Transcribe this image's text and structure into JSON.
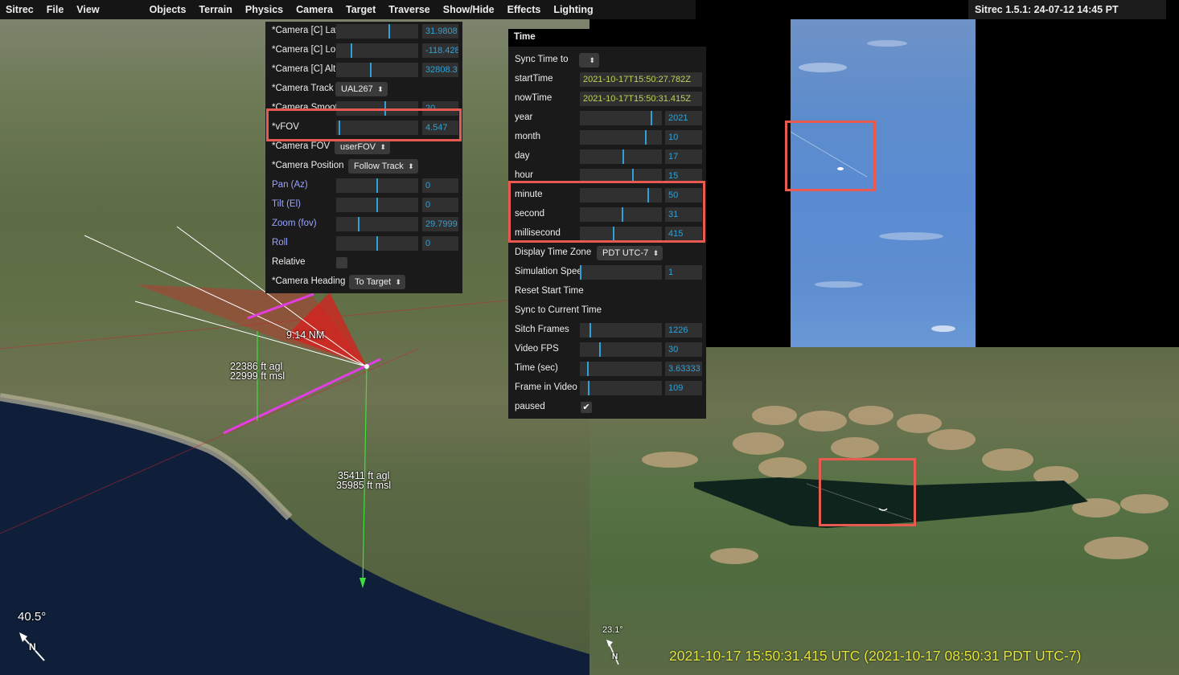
{
  "menu": {
    "app": "Sitrec",
    "items": [
      "File",
      "View",
      "Objects",
      "Terrain",
      "Physics",
      "Camera",
      "Target",
      "Traverse",
      "Show/Hide",
      "Effects",
      "Lighting"
    ],
    "version": "Sitrec 1.5.1: 24-07-12 14:45 PT"
  },
  "camera_panel": {
    "rows": [
      {
        "label": "*Camera [C] Lat",
        "type": "slider",
        "value": "31.9808",
        "level": 0.65
      },
      {
        "label": "*Camera [C] Lon",
        "type": "slider",
        "value": "-118.428",
        "level": 0.18
      },
      {
        "label": "*Camera [C] Alt (ft)",
        "type": "slider",
        "value": "32808.3",
        "level": 0.42
      },
      {
        "label": "*Camera Track",
        "type": "select",
        "value": "UAL267"
      },
      {
        "label": "*Camera Smooth Window",
        "type": "slider",
        "value": "20",
        "level": 0.6
      },
      {
        "label": "*vFOV",
        "type": "slider",
        "value": "4.547",
        "level": 0.03
      },
      {
        "label": "*Camera FOV",
        "type": "select",
        "value": "userFOV"
      },
      {
        "label": "*Camera Position",
        "type": "select",
        "value": "Follow Track"
      },
      {
        "label": "Pan (Az)",
        "type": "slider",
        "value": "0",
        "level": 0.5,
        "blue": true
      },
      {
        "label": "Tilt (El)",
        "type": "slider",
        "value": "0",
        "level": 0.5,
        "blue": true
      },
      {
        "label": "Zoom (fov)",
        "type": "slider",
        "value": "29.7999",
        "level": 0.27,
        "blue": true
      },
      {
        "label": "Roll",
        "type": "slider",
        "value": "0",
        "level": 0.5,
        "blue": true
      },
      {
        "label": "Relative",
        "type": "check",
        "checked": false
      },
      {
        "label": "*Camera Heading",
        "type": "select",
        "value": "To Target"
      }
    ]
  },
  "time_panel": {
    "title": "Time",
    "rows": [
      {
        "label": "Sync Time to",
        "type": "select",
        "value": ""
      },
      {
        "label": "startTime",
        "type": "text",
        "value": "2021-10-17T15:50:27.782Z"
      },
      {
        "label": "nowTime",
        "type": "text",
        "value": "2021-10-17T15:50:31.415Z"
      },
      {
        "label": "year",
        "type": "slider",
        "value": "2021",
        "level": 0.88
      },
      {
        "label": "month",
        "type": "slider",
        "value": "10",
        "level": 0.81
      },
      {
        "label": "day",
        "type": "slider",
        "value": "17",
        "level": 0.53
      },
      {
        "label": "hour",
        "type": "slider",
        "value": "15",
        "level": 0.65
      },
      {
        "label": "minute",
        "type": "slider",
        "value": "50",
        "level": 0.84
      },
      {
        "label": "second",
        "type": "slider",
        "value": "31",
        "level": 0.52
      },
      {
        "label": "millisecond",
        "type": "slider",
        "value": "415",
        "level": 0.41
      },
      {
        "label": "Display Time Zone",
        "type": "select",
        "value": "PDT UTC-7"
      },
      {
        "label": "Simulation Speed",
        "type": "slider",
        "value": "1",
        "level": 0.0
      },
      {
        "label": "Reset Start Time",
        "type": "button"
      },
      {
        "label": "Sync to Current Time",
        "type": "button"
      },
      {
        "label": "Sitch Frames",
        "type": "slider",
        "value": "1226",
        "level": 0.12
      },
      {
        "label": "Video FPS",
        "type": "slider",
        "value": "30",
        "level": 0.24
      },
      {
        "label": "Time (sec)",
        "type": "slider",
        "value": "3.63333",
        "level": 0.09
      },
      {
        "label": "Frame in Video",
        "type": "slider",
        "value": "109",
        "level": 0.1
      },
      {
        "label": "paused",
        "type": "check",
        "checked": true
      }
    ]
  },
  "main_view": {
    "distance_label": "9.14 NM",
    "target_alt_agl": "22386 ft agl",
    "target_alt_msl": "22999 ft msl",
    "camera_alt_agl": "35411 ft agl",
    "camera_alt_msl": "35985 ft msl",
    "compass_angle": "40.5°",
    "compass_letter": "N"
  },
  "look_view": {
    "compass_angle": "23.1°",
    "compass_letter": "N",
    "timestamp": "2021-10-17 15:50:31.415 UTC  (2021-10-17 08:50:31 PDT UTC-7)"
  },
  "colors": {
    "highlight": "#e8594f",
    "accent": "#2fa1d6",
    "timestamp": "#e4e43a"
  }
}
